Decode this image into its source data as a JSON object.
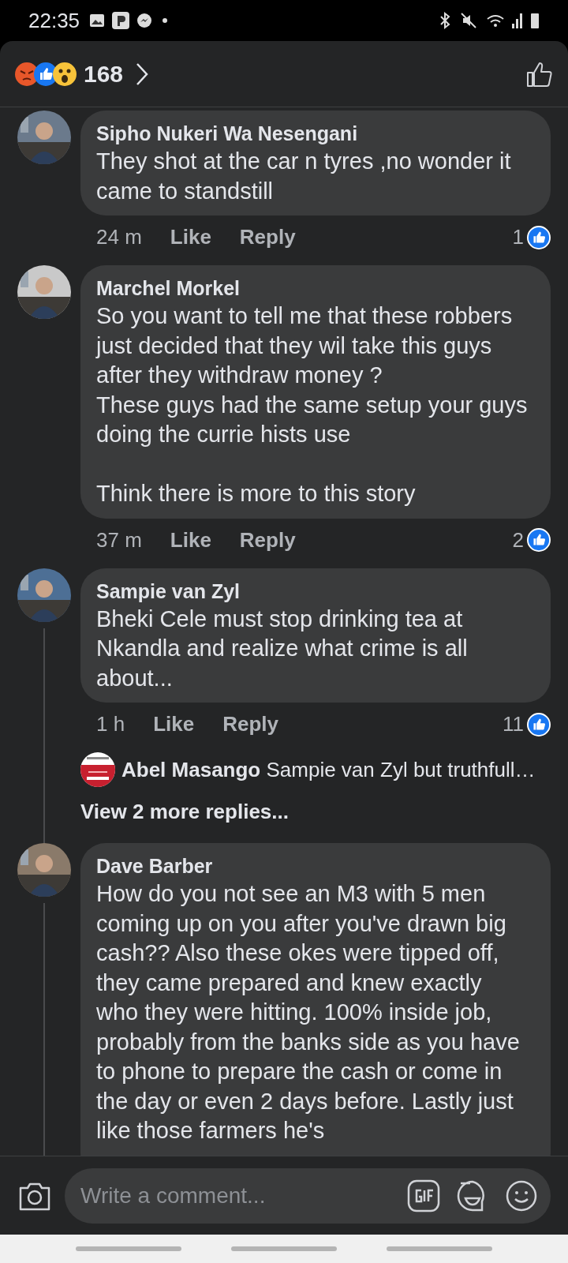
{
  "status_bar": {
    "time": "22:35"
  },
  "header": {
    "reactions": [
      {
        "kind": "angry"
      },
      {
        "kind": "like"
      },
      {
        "kind": "wow"
      }
    ],
    "count": "168"
  },
  "comments": [
    {
      "author": "Sipho Nukeri Wa Nesengani",
      "text": "They shot at the car n tyres ,no wonder it came to standstill",
      "time": "24 m",
      "like": "Like",
      "reply": "Reply",
      "reactions": "1"
    },
    {
      "author": "Marchel Morkel",
      "text": "So you want to tell me that these robbers just decided that they wil take this guys after they withdraw money ?\nThese guys had the same setup your guys doing the currie hists use\n\nThink there is more to this story",
      "time": "37 m",
      "like": "Like",
      "reply": "Reply",
      "reactions": "2"
    },
    {
      "author": "Sampie van Zyl",
      "text": "Bheki Cele must stop drinking tea at Nkandla and realize what crime is all about...",
      "time": "1 h",
      "like": "Like",
      "reply": "Reply",
      "reactions": "11",
      "replies": {
        "preview_author": "Abel Masango",
        "preview_text": "Sampie van Zyl but truthfull…",
        "more": "View 2 more replies..."
      }
    },
    {
      "author": "Dave Barber",
      "text": "How do you not see an M3 with 5 men coming up on you after you've drawn big cash?? Also these okes were tipped off, they came prepared and knew exactly who they were hitting. 100% inside job, probably from the banks side as you have to phone to prepare the cash or come in the day or even 2 days before. Lastly just like those farmers he's",
      "thread": true
    }
  ],
  "composer": {
    "placeholder": "Write a comment..."
  }
}
